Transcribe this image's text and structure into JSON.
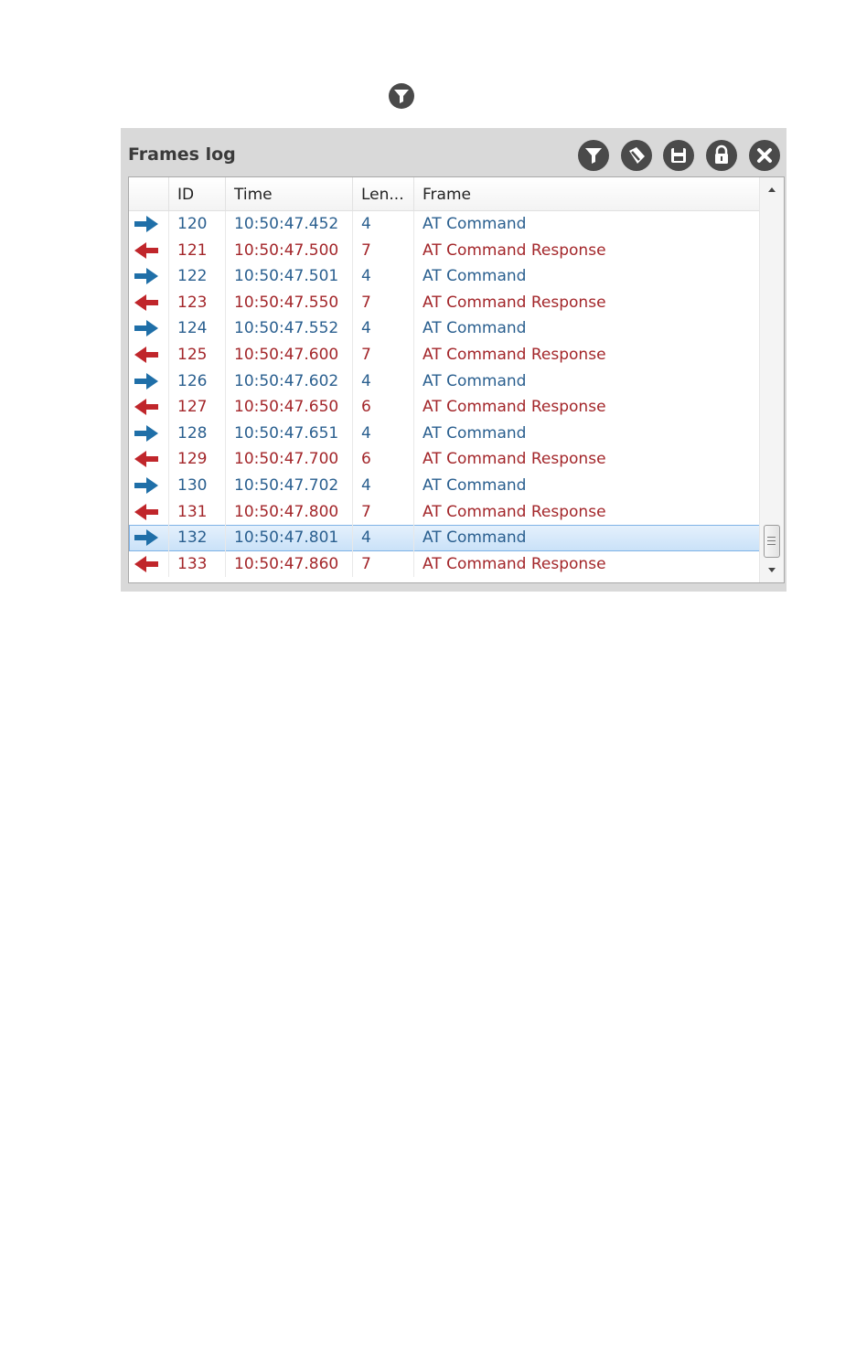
{
  "standalone_icon": "filter-icon",
  "panel": {
    "title": "Frames log",
    "toolbar": [
      {
        "name": "filter-button",
        "icon": "filter-icon"
      },
      {
        "name": "clear-button",
        "icon": "eraser-icon"
      },
      {
        "name": "save-button",
        "icon": "save-icon"
      },
      {
        "name": "lock-button",
        "icon": "lock-icon"
      },
      {
        "name": "close-button",
        "icon": "close-icon"
      }
    ]
  },
  "table": {
    "columns": [
      "ID",
      "Time",
      "Len...",
      "Frame"
    ],
    "rows": [
      {
        "dir": "out",
        "id": "120",
        "time": "10:50:47.452",
        "len": "4",
        "frame": "AT Command"
      },
      {
        "dir": "in",
        "id": "121",
        "time": "10:50:47.500",
        "len": "7",
        "frame": "AT Command Response"
      },
      {
        "dir": "out",
        "id": "122",
        "time": "10:50:47.501",
        "len": "4",
        "frame": "AT Command"
      },
      {
        "dir": "in",
        "id": "123",
        "time": "10:50:47.550",
        "len": "7",
        "frame": "AT Command Response"
      },
      {
        "dir": "out",
        "id": "124",
        "time": "10:50:47.552",
        "len": "4",
        "frame": "AT Command"
      },
      {
        "dir": "in",
        "id": "125",
        "time": "10:50:47.600",
        "len": "7",
        "frame": "AT Command Response"
      },
      {
        "dir": "out",
        "id": "126",
        "time": "10:50:47.602",
        "len": "4",
        "frame": "AT Command"
      },
      {
        "dir": "in",
        "id": "127",
        "time": "10:50:47.650",
        "len": "6",
        "frame": "AT Command Response"
      },
      {
        "dir": "out",
        "id": "128",
        "time": "10:50:47.651",
        "len": "4",
        "frame": "AT Command"
      },
      {
        "dir": "in",
        "id": "129",
        "time": "10:50:47.700",
        "len": "6",
        "frame": "AT Command Response"
      },
      {
        "dir": "out",
        "id": "130",
        "time": "10:50:47.702",
        "len": "4",
        "frame": "AT Command"
      },
      {
        "dir": "in",
        "id": "131",
        "time": "10:50:47.800",
        "len": "7",
        "frame": "AT Command Response"
      },
      {
        "dir": "out",
        "id": "132",
        "time": "10:50:47.801",
        "len": "4",
        "frame": "AT Command",
        "selected": true
      },
      {
        "dir": "in",
        "id": "133",
        "time": "10:50:47.860",
        "len": "7",
        "frame": "AT Command Response"
      }
    ]
  },
  "colors": {
    "outgoing": "#1f6fa8",
    "incoming": "#c0262b",
    "outgoing_text": "#2a5f8f",
    "incoming_text": "#a3262a",
    "toolbar_icon_bg": "#4a4a4a"
  }
}
